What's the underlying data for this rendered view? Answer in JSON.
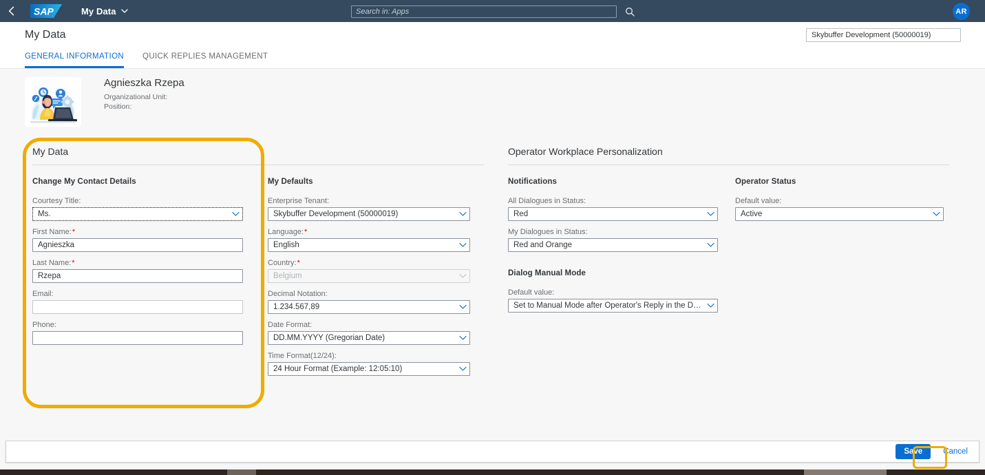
{
  "shell": {
    "back_label": "Back",
    "logo_text": "SAP",
    "app_title": "My Data",
    "search_placeholder": "Search in: Apps",
    "search_value": "",
    "avatar_initials": "AR"
  },
  "page": {
    "title": "My Data",
    "tenant_value": "Skybuffer Development (50000019)",
    "tabs": [
      {
        "label": "GENERAL INFORMATION",
        "active": true
      },
      {
        "label": "QUICK REPLIES MANAGEMENT",
        "active": false
      }
    ]
  },
  "profile": {
    "name": "Agnieszka Rzepa",
    "org_unit_label": "Organizational Unit:",
    "position_label": "Position:"
  },
  "my_data_panel": {
    "title": "My Data",
    "contact_group": {
      "title": "Change My Contact Details",
      "fields": {
        "courtesy_title_label": "Courtesy Title:",
        "courtesy_title_value": "Ms.",
        "first_name_label": "First Name:",
        "first_name_value": "Agnieszka",
        "last_name_label": "Last Name:",
        "last_name_value": "Rzepa",
        "email_label": "Email:",
        "email_value": "",
        "phone_label": "Phone:",
        "phone_value": ""
      }
    },
    "defaults_group": {
      "title": "My Defaults",
      "fields": {
        "tenant_label": "Enterprise Tenant:",
        "tenant_value": "Skybuffer Development (50000019)",
        "language_label": "Language:",
        "language_value": "English",
        "country_label": "Country:",
        "country_value": "Belgium",
        "decimal_label": "Decimal Notation:",
        "decimal_value": "1.234.567,89",
        "date_format_label": "Date Format:",
        "date_format_value": "DD.MM.YYYY (Gregorian Date)",
        "time_format_label": "Time Format(12/24):",
        "time_format_value": "24 Hour Format (Example: 12:05:10)"
      }
    }
  },
  "owp_panel": {
    "title": "Operator Workplace Personalization",
    "notifications_group": {
      "title": "Notifications",
      "all_dialogues_label": "All Dialogues in Status:",
      "all_dialogues_value": "Red",
      "my_dialogues_label": "My Dialogues in Status:",
      "my_dialogues_value": "Red and Orange"
    },
    "manual_mode_group": {
      "title": "Dialog Manual Mode",
      "default_label": "Default value:",
      "default_value": "Set to Manual Mode after Operator's Reply in the Dialog"
    },
    "operator_status_group": {
      "title": "Operator Status",
      "default_label": "Default value:",
      "default_value": "Active"
    }
  },
  "footer": {
    "save_label": "Save",
    "cancel_label": "Cancel"
  },
  "colors": {
    "shell_bg": "#354a5f",
    "accent": "#0a6ed1",
    "highlight": "#f0ab00",
    "required": "#ee0000",
    "page_bg": "#f7f7f7"
  }
}
